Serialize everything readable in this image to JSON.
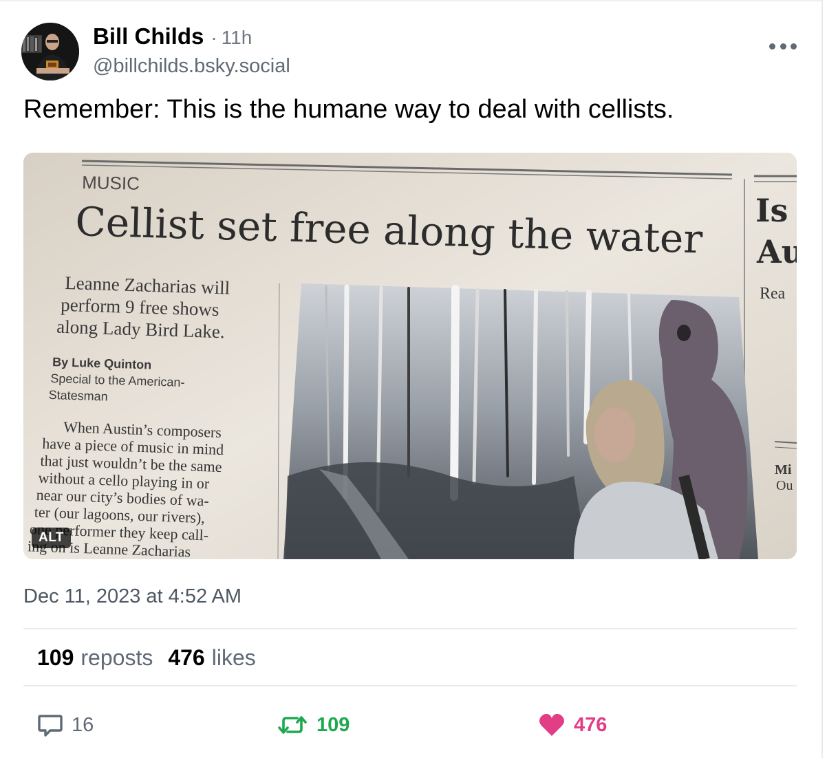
{
  "post": {
    "author_name": "Bill Childs",
    "separator": "·",
    "time_ago": "11h",
    "handle": "@billchilds.bsky.social",
    "text": "Remember: This is the humane way to deal with cellists.",
    "timestamp": "Dec 11, 2023 at 4:52 AM"
  },
  "image": {
    "alt_badge": "ALT",
    "newspaper": {
      "section": "MUSIC",
      "headline": "Cellist set free along the water",
      "deck": [
        "Leanne Zacharias will",
        "perform 9 free shows",
        "along Lady Bird Lake."
      ],
      "byline": "By Luke Quinton",
      "credit": [
        "Special to the American-",
        "Statesman"
      ],
      "body": [
        "When Austin’s composers",
        "have a piece of music in mind",
        "that just wouldn’t be the same",
        "without a cello playing in or",
        "near our city’s bodies of wa-",
        "ter (our lagoons, our rivers),",
        "one performer they keep call-",
        "ing on is Leanne Zacharias"
      ],
      "side_headline": [
        "Is",
        "Au"
      ],
      "side_text": [
        "Rea",
        "Mi",
        "Ou"
      ]
    }
  },
  "stats": {
    "reposts_count": "109",
    "reposts_label": "reposts",
    "likes_count": "476",
    "likes_label": "likes"
  },
  "actions": {
    "reply_count": "16",
    "repost_count": "109",
    "like_count": "476"
  },
  "colors": {
    "repost_green": "#1fa84f",
    "like_pink": "#e23e86",
    "muted_text": "#5f6a76"
  }
}
